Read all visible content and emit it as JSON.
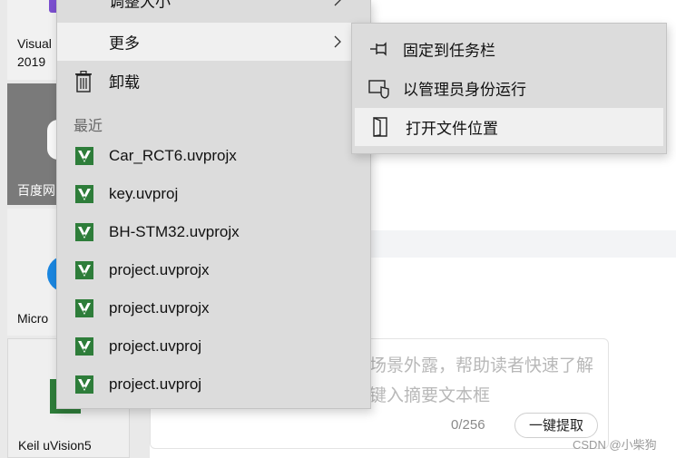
{
  "tiles": [
    {
      "label": "Visual\n2019",
      "icon": "visual-studio-icon"
    },
    {
      "label": "百度网",
      "icon": "baidu-netdisk-icon"
    },
    {
      "label": "Micro",
      "icon": "edge-icon"
    },
    {
      "label": "Keil uVision5",
      "icon": "keil-icon"
    }
  ],
  "editor": {
    "placeholder_line1": "场景外露，帮助读者快速了解",
    "placeholder_line2": "键入摘要文本框",
    "counter": "0/256",
    "extract_button": "一键提取",
    "watermark": "CSDN @小柴狗"
  },
  "context_menu": {
    "top_item": "调整大小",
    "more": "更多",
    "uninstall": "卸载",
    "recent_header": "最近",
    "recent_files": [
      "Car_RCT6.uvprojx",
      "key.uvproj",
      "BH-STM32.uvprojx",
      "project.uvprojx",
      "project.uvprojx",
      "project.uvproj",
      "project.uvproj"
    ],
    "recent_file_icon": "keil-project-icon"
  },
  "submenu": {
    "items": [
      {
        "label": "固定到任务栏",
        "icon": "pin-icon"
      },
      {
        "label": "以管理员身份运行",
        "icon": "shield-icon"
      },
      {
        "label": "打开文件位置",
        "icon": "folder-open-icon"
      }
    ],
    "highlighted_index": 2
  },
  "colors": {
    "menu_bg": "#dcdcdc",
    "menu_hover": "#f0f0f0",
    "keil_green": "#2e7d3a",
    "baidu_tile": "#7a7a7a",
    "edge_blue": "#1a86e0"
  }
}
